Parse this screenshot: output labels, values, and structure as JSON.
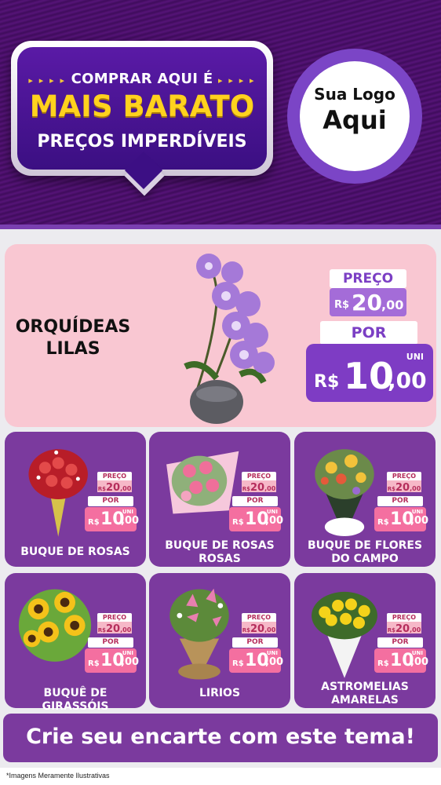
{
  "header": {
    "bubble_line1": "COMPRAR AQUI É",
    "bubble_line2": "MAIS BARATO",
    "bubble_line3": "PREÇOS IMPERDÍVEIS",
    "dots_left": "▸ ▸ ▸ ▸",
    "dots_right": "▸ ▸ ▸ ▸",
    "logo_line1": "Sua Logo",
    "logo_line2": "Aqui"
  },
  "hero": {
    "product": "ORQUÍDEAS LILAS",
    "price_label": "PREÇO",
    "currency": "R$",
    "old_price_int": "20",
    "old_price_dec": ",00",
    "por_label": "POR",
    "unit": "UNI",
    "new_price_int": "10",
    "new_price_dec": ",00"
  },
  "cards": [
    {
      "name": "BUQUE DE ROSAS",
      "price_label": "PREÇO",
      "currency": "R$",
      "old_int": "20",
      "old_dec": ",00",
      "por": "POR",
      "unit": "UNI",
      "new_int": "10",
      "new_dec": ",00",
      "image": "bouquet-red-roses"
    },
    {
      "name": "BUQUE DE ROSAS ROSAS",
      "price_label": "PREÇO",
      "currency": "R$",
      "old_int": "20",
      "old_dec": ",00",
      "por": "POR",
      "unit": "UNI",
      "new_int": "10",
      "new_dec": ",00",
      "image": "bouquet-pink-roses"
    },
    {
      "name": "BUQUE DE FLORES DO CAMPO",
      "price_label": "PREÇO",
      "currency": "R$",
      "old_int": "20",
      "old_dec": ",00",
      "por": "POR",
      "unit": "UNI",
      "new_int": "10",
      "new_dec": ",00",
      "image": "bouquet-wildflowers"
    },
    {
      "name": "BUQUÊ DE GIRASSÓIS",
      "price_label": "PREÇO",
      "currency": "R$",
      "old_int": "20",
      "old_dec": ",00",
      "por": "POR",
      "unit": "UNI",
      "new_int": "10",
      "new_dec": ",00",
      "image": "bouquet-sunflowers"
    },
    {
      "name": "LIRIOS",
      "price_label": "PREÇO",
      "currency": "R$",
      "old_int": "20",
      "old_dec": ",00",
      "por": "POR",
      "unit": "UNI",
      "new_int": "10",
      "new_dec": ",00",
      "image": "bouquet-lilies"
    },
    {
      "name": "ASTROMELIAS AMARELAS",
      "price_label": "PREÇO",
      "currency": "R$",
      "old_int": "20",
      "old_dec": ",00",
      "por": "POR",
      "unit": "UNI",
      "new_int": "10",
      "new_dec": ",00",
      "image": "bouquet-yellow-roses"
    }
  ],
  "footer": {
    "cta": "Crie seu encarte com este tema!",
    "disclaimer": "*Imagens Meramente Ilustrativas"
  },
  "colors": {
    "header_purple": "#4a0f6a",
    "card_purple": "#7b3a9e",
    "hero_pink": "#f9c7d2",
    "price_pink": "#f46fa0",
    "accent_yellow": "#ffd21e"
  }
}
